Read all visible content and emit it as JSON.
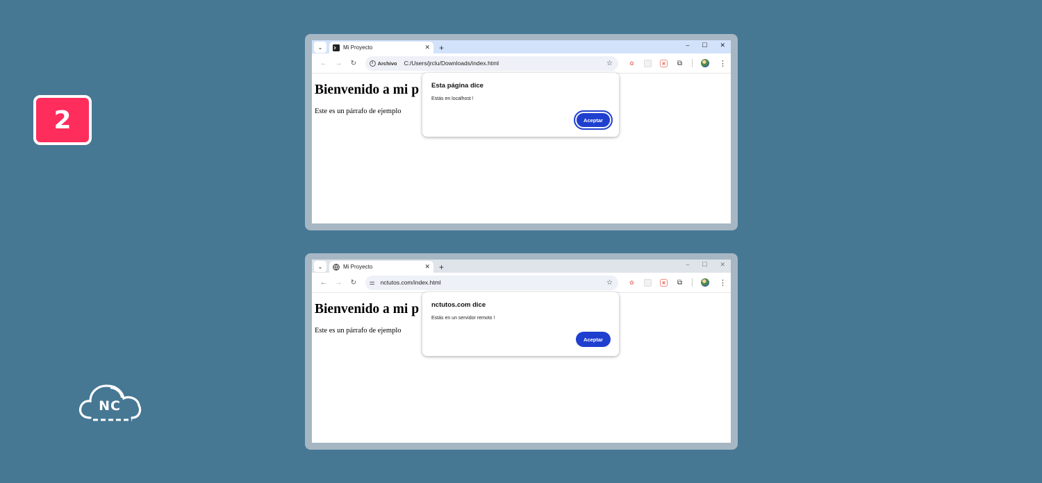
{
  "step_number": "2",
  "logo_text": "NC",
  "browsers": [
    {
      "tab_title": "Mi Proyecto",
      "chip_label": "Archivo",
      "url": "C:/Users/jrclu/Downloads/index.html",
      "page_heading": "Bienvenido a mi p",
      "page_paragraph": "Este es un párrafo de ejemplo",
      "dialog_title": "Esta página dice",
      "dialog_message": "Estás en localhost !",
      "dialog_button": "Aceptar"
    },
    {
      "tab_title": "Mi Proyecto",
      "url": "nctutos.com/index.html",
      "page_heading": "Bienvenido a mi p",
      "page_paragraph": "Este es un párrafo de ejemplo",
      "dialog_title": "nctutos.com dice",
      "dialog_message": "Estás en un servidor remoto !",
      "dialog_button": "Aceptar"
    }
  ],
  "colors": {
    "background": "#467894",
    "badge": "#ff2d5c",
    "accept_button": "#1f3fcf"
  }
}
